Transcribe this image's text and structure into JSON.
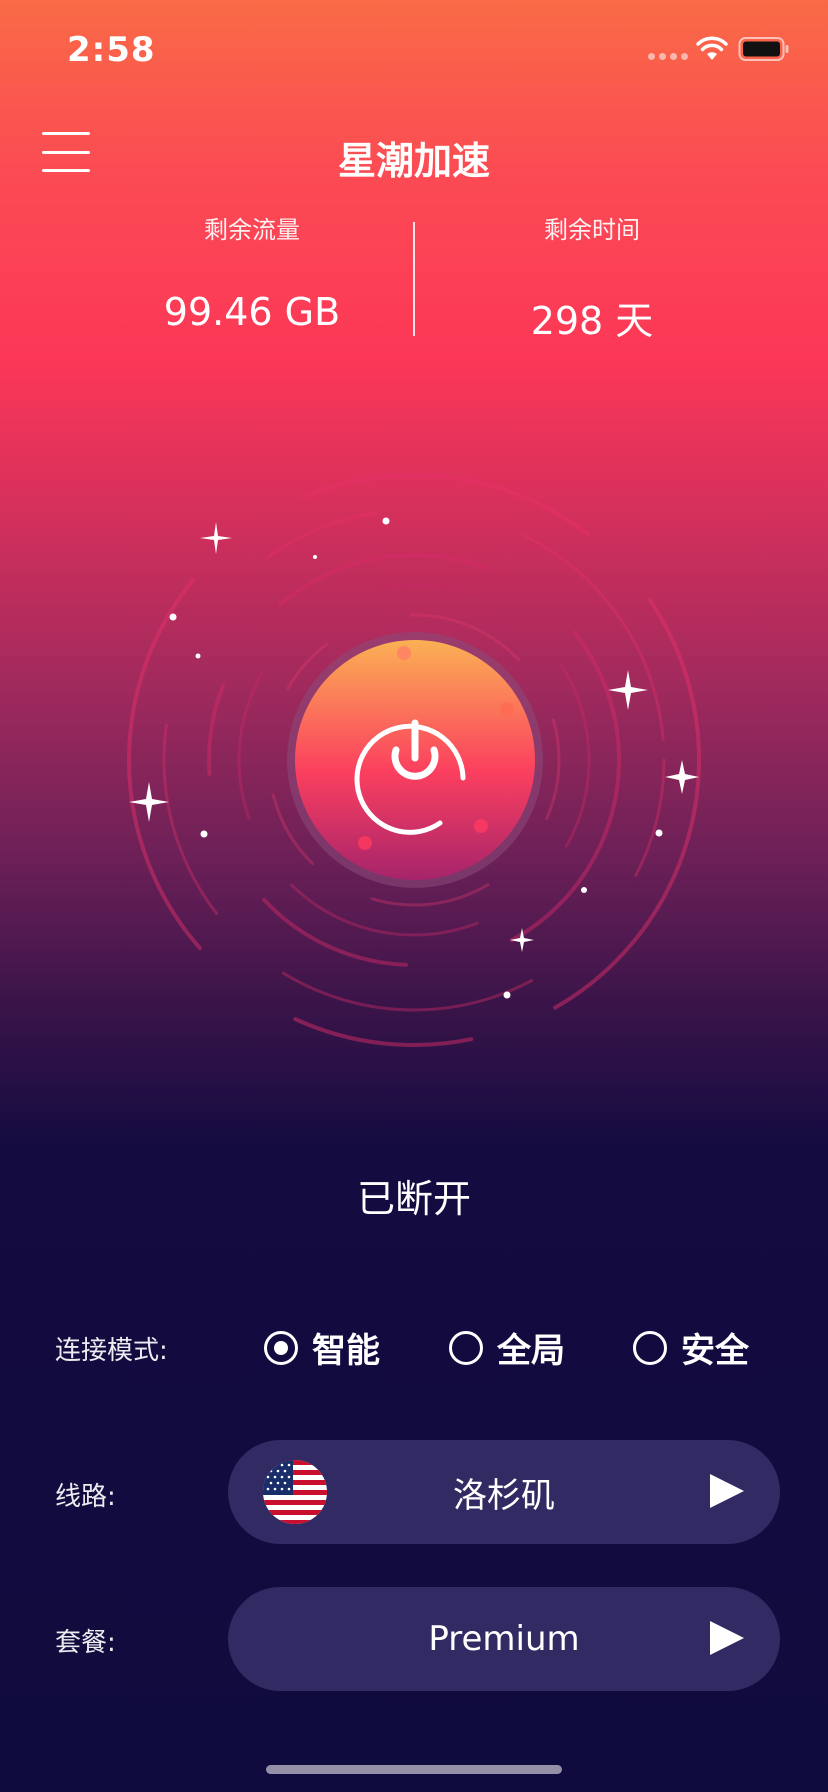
{
  "status_bar": {
    "time": "2:58"
  },
  "header": {
    "title": "星潮加速"
  },
  "stats": {
    "traffic": {
      "label": "剩余流量",
      "value": "99.46 GB"
    },
    "time_left": {
      "label": "剩余时间",
      "value": "298 天"
    }
  },
  "connection": {
    "status": "已断开"
  },
  "mode": {
    "label": "连接模式:",
    "options": [
      "智能",
      "全局",
      "安全"
    ],
    "selected": "智能"
  },
  "route": {
    "label": "线路:",
    "value": "洛杉矶",
    "flag": "us-flag-icon"
  },
  "plan": {
    "label": "套餐:",
    "value": "Premium"
  },
  "colors": {
    "accent": "#fc3757",
    "background_dark": "#100b3e",
    "pill": "#322a63",
    "power_top": "#fbb054",
    "power_bottom": "#b0276a"
  }
}
